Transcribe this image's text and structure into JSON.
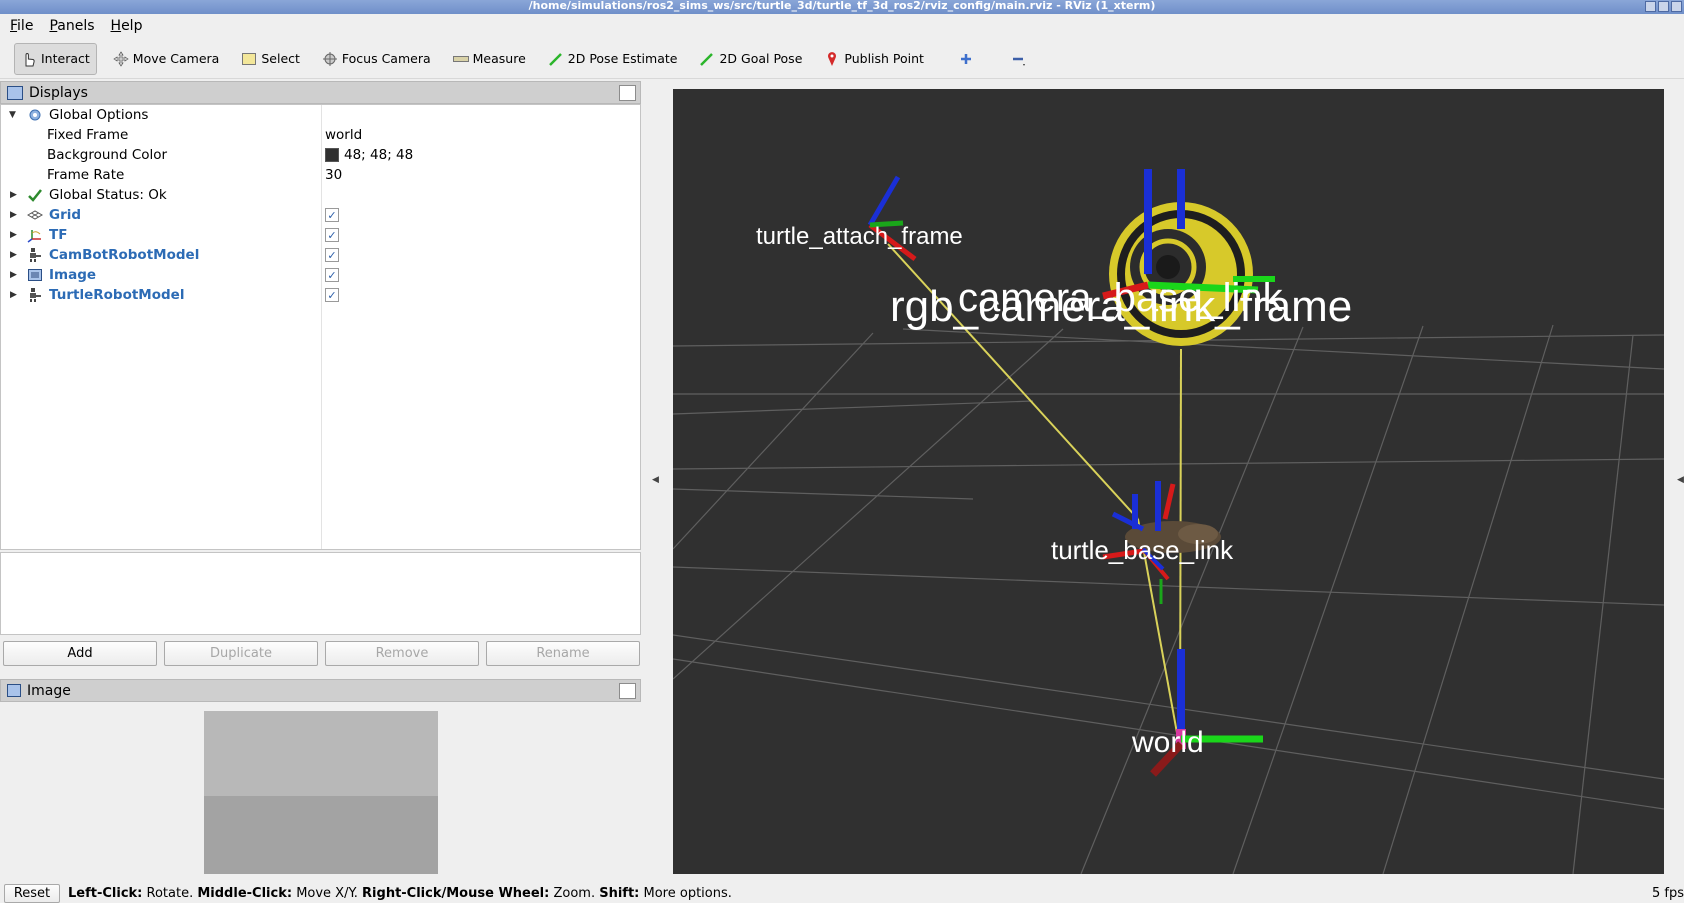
{
  "window": {
    "title": "/home/simulations/ros2_sims_ws/src/turtle_3d/turtle_tf_3d_ros2/rviz_config/main.rviz - RViz (1_xterm)"
  },
  "menu": {
    "items": [
      "File",
      "Panels",
      "Help"
    ]
  },
  "toolbar": {
    "tools": [
      {
        "label": "Interact",
        "icon": "hand-cursor-icon",
        "active": true
      },
      {
        "label": "Move Camera",
        "icon": "move-camera-icon",
        "active": false
      },
      {
        "label": "Select",
        "icon": "select-box-icon",
        "active": false
      },
      {
        "label": "Focus Camera",
        "icon": "focus-camera-icon",
        "active": false
      },
      {
        "label": "Measure",
        "icon": "ruler-icon",
        "active": false
      },
      {
        "label": "2D Pose Estimate",
        "icon": "green-arrow-icon",
        "active": false
      },
      {
        "label": "2D Goal Pose",
        "icon": "green-arrow-icon",
        "active": false
      },
      {
        "label": "Publish Point",
        "icon": "map-pin-icon",
        "active": false
      }
    ]
  },
  "displays": {
    "title": "Displays",
    "global_options": {
      "label": "Global Options",
      "fixed_frame": {
        "label": "Fixed Frame",
        "value": "world"
      },
      "background_color": {
        "label": "Background Color",
        "value": "48; 48; 48",
        "swatch": "#303030"
      },
      "frame_rate": {
        "label": "Frame Rate",
        "value": "30"
      }
    },
    "global_status": {
      "label": "Global Status: Ok"
    },
    "items": [
      {
        "label": "Grid",
        "checked": true,
        "icon": "grid-icon"
      },
      {
        "label": "TF",
        "checked": true,
        "icon": "tf-axes-icon"
      },
      {
        "label": "CamBotRobotModel",
        "checked": true,
        "icon": "robot-model-icon"
      },
      {
        "label": "Image",
        "checked": true,
        "icon": "image-icon"
      },
      {
        "label": "TurtleRobotModel",
        "checked": true,
        "icon": "robot-model-icon"
      }
    ],
    "check_mark": "✓",
    "buttons": {
      "add": "Add",
      "duplicate": "Duplicate",
      "remove": "Remove",
      "rename": "Rename"
    }
  },
  "image_panel": {
    "title": "Image"
  },
  "viewport": {
    "background": "#303030",
    "frame_labels": {
      "turtle_attach": "turtle_attach_frame",
      "camera_base": "camera_base_link",
      "rgb_camera": "rgb_camera_link_frame",
      "turtle_cluster": "turtle_base_link",
      "world": "world"
    }
  },
  "status": {
    "reset": "Reset",
    "left_click": "Left-Click:",
    "left_click_action": "Rotate.",
    "middle_click": "Middle-Click:",
    "middle_click_action": "Move X/Y.",
    "right_click": "Right-Click/Mouse Wheel:",
    "right_click_action": "Zoom.",
    "shift": "Shift:",
    "shift_action": "More options.",
    "fps": "5 fps"
  }
}
